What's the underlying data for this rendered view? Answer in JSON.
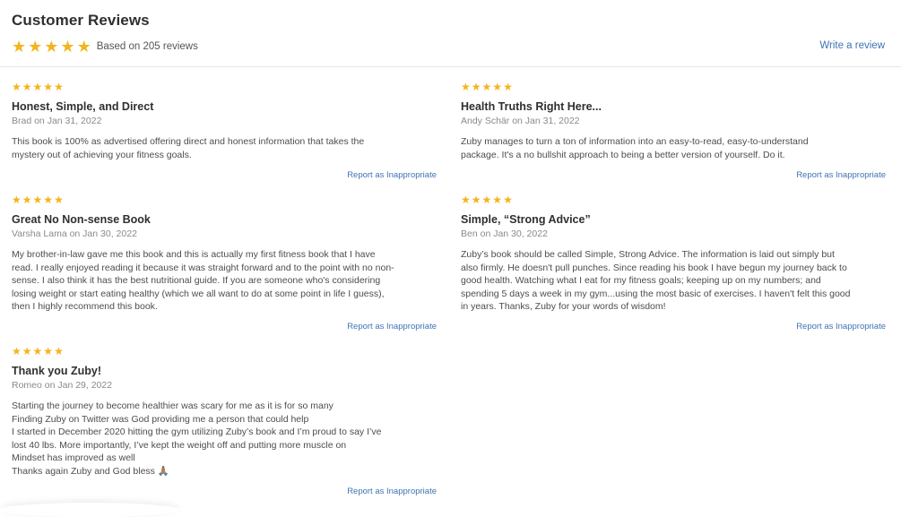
{
  "header": {
    "title": "Customer Reviews",
    "rating_stars": 5,
    "summary": "Based on 205 reviews",
    "write_review": "Write a review"
  },
  "star_glyph": "★",
  "star_color": "#f2b51a",
  "link_color": "#3f73b6",
  "reviews": [
    {
      "rating": 5,
      "title": "Honest, Simple, and Direct",
      "meta": "Brad on Jan 31, 2022",
      "body_lines": [
        "This book is 100% as advertised offering direct and honest information that takes the",
        "mystery out of achieving your fitness goals."
      ],
      "report": "Report as Inappropriate"
    },
    {
      "rating": 5,
      "title": "Health Truths Right Here...",
      "meta": "Andy Schär on Jan 31, 2022",
      "body_lines": [
        "Zuby manages to turn a ton of information into an easy-to-read, easy-to-understand",
        "package. It's a no bullshit approach to being a better version of yourself. Do it."
      ],
      "report": "Report as Inappropriate"
    },
    {
      "rating": 5,
      "title": "Great No Non-sense Book",
      "meta": "Varsha Lama on Jan 30, 2022",
      "body_lines": [
        "My brother-in-law gave me this book and this is actually my first fitness book that I have",
        "read. I really enjoyed reading it because it was straight forward and to the point with no non-",
        "sense. I also think it has the best nutritional guide. If you are someone who's considering",
        "losing weight or start eating healthy (which we all want to do at some point in life I guess),",
        "then I highly recommend this book."
      ],
      "report": "Report as Inappropriate"
    },
    {
      "rating": 5,
      "title": "Simple, “Strong Advice”",
      "meta": "Ben on Jan 30, 2022",
      "body_lines": [
        "Zuby’s book should be called Simple, Strong Advice. The information is laid out simply but",
        "also firmly. He doesn't pull punches. Since reading his book I have begun my journey back to",
        "good health. Watching what I eat for my fitness goals; keeping up on my numbers; and",
        "spending 5 days a week in my gym...using the most basic of exercises. I haven't felt this good",
        "in years. Thanks, Zuby for your words of wisdom!"
      ],
      "report": "Report as Inappropriate"
    },
    {
      "rating": 5,
      "title": "Thank you Zuby!",
      "meta": "Romeo on Jan 29, 2022",
      "body_lines": [
        "Starting the journey to become healthier was scary for me as it is for so many",
        "Finding Zuby on Twitter was God providing me a person that could help",
        "I started in December 2020 hitting the gym utilizing Zuby’s book and I’m proud to say I’ve",
        "lost 40 lbs. More importantly, I’ve kept the weight off and putting more muscle on",
        "Mindset has improved as well",
        "Thanks again Zuby and God bless 🙏🏽"
      ],
      "report": "Report as Inappropriate"
    }
  ]
}
